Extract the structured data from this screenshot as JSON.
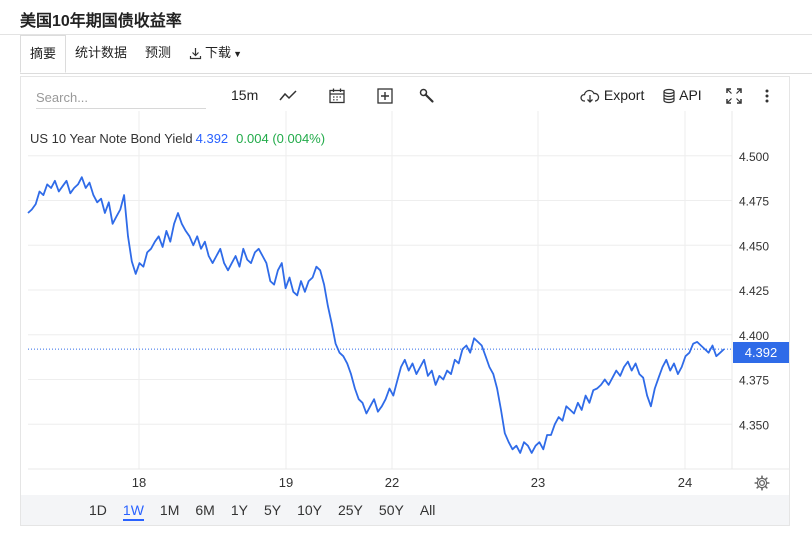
{
  "title": "美国10年期国债收益率",
  "tabs": {
    "items": [
      {
        "label": "摘要",
        "active": true
      },
      {
        "label": "统计数据",
        "active": false
      },
      {
        "label": "预测",
        "active": false
      },
      {
        "label": "下载",
        "active": false
      }
    ]
  },
  "toolbar": {
    "search_placeholder": "Search...",
    "interval": "15m",
    "export_label": "Export",
    "api_label": "API"
  },
  "legend": {
    "name": "US 10 Year Note Bond Yield",
    "value": "4.392",
    "change": "0.004 (0.004%)"
  },
  "price_tag": "4.392",
  "ranges": [
    "1D",
    "1W",
    "1M",
    "6M",
    "1Y",
    "5Y",
    "10Y",
    "25Y",
    "50Y",
    "All"
  ],
  "active_range": "1W",
  "colors": {
    "line": "#2f6be8",
    "up": "#22ab4a",
    "accent": "#2962ff"
  },
  "chart_data": {
    "type": "line",
    "ylim": [
      4.325,
      4.525
    ],
    "y_ticks": [
      "4.500",
      "4.475",
      "4.450",
      "4.425",
      "4.400",
      "4.375",
      "4.350"
    ],
    "x_ticks": [
      "18",
      "19",
      "22",
      "23",
      "24"
    ],
    "last_value": 4.392,
    "series": [
      {
        "values": [
          4.468,
          4.47,
          4.473,
          4.48,
          4.478,
          4.484,
          4.482,
          4.486,
          4.48,
          4.483,
          4.486,
          4.479,
          4.482,
          4.484,
          4.488,
          4.482,
          4.485,
          4.478,
          4.474,
          4.476,
          4.468,
          4.474,
          4.462,
          4.466,
          4.47,
          4.478,
          4.455,
          4.441,
          4.434,
          4.44,
          4.438,
          4.446,
          4.448,
          4.452,
          4.455,
          4.449,
          4.458,
          4.452,
          4.462,
          4.468,
          4.462,
          4.458,
          4.455,
          4.45,
          4.455,
          4.448,
          4.452,
          4.444,
          4.44,
          4.444,
          4.448,
          4.44,
          4.436,
          4.44,
          4.444,
          4.438,
          4.448,
          4.442,
          4.44,
          4.446,
          4.448,
          4.444,
          4.44,
          4.43,
          4.428,
          4.436,
          4.44,
          4.426,
          4.432,
          4.424,
          4.422,
          4.43,
          4.424,
          4.43,
          4.432,
          4.438,
          4.436,
          4.428,
          4.416,
          4.406,
          4.395,
          4.39,
          4.388,
          4.384,
          4.378,
          4.37,
          4.364,
          4.362,
          4.356,
          4.36,
          4.364,
          4.357,
          4.36,
          4.364,
          4.37,
          4.366,
          4.374,
          4.382,
          4.386,
          4.38,
          4.384,
          4.378,
          4.382,
          4.386,
          4.377,
          4.38,
          4.372,
          4.377,
          4.375,
          4.38,
          4.378,
          4.386,
          4.384,
          4.392,
          4.394,
          4.39,
          4.398,
          4.396,
          4.394,
          4.388,
          4.382,
          4.378,
          4.37,
          4.358,
          4.345,
          4.34,
          4.336,
          4.338,
          4.334,
          4.34,
          4.338,
          4.334,
          4.338,
          4.34,
          4.336,
          4.344,
          4.344,
          4.35,
          4.354,
          4.352,
          4.36,
          4.358,
          4.356,
          4.362,
          4.358,
          4.366,
          4.362,
          4.369,
          4.37,
          4.372,
          4.375,
          4.372,
          4.376,
          4.38,
          4.377,
          4.382,
          4.385,
          4.38,
          4.384,
          4.378,
          4.376,
          4.366,
          4.36,
          4.37,
          4.376,
          4.382,
          4.386,
          4.38,
          4.384,
          4.378,
          4.382,
          4.388,
          4.39,
          4.395,
          4.396,
          4.394,
          4.392,
          4.39,
          4.394,
          4.388,
          4.39,
          4.392
        ]
      }
    ]
  }
}
